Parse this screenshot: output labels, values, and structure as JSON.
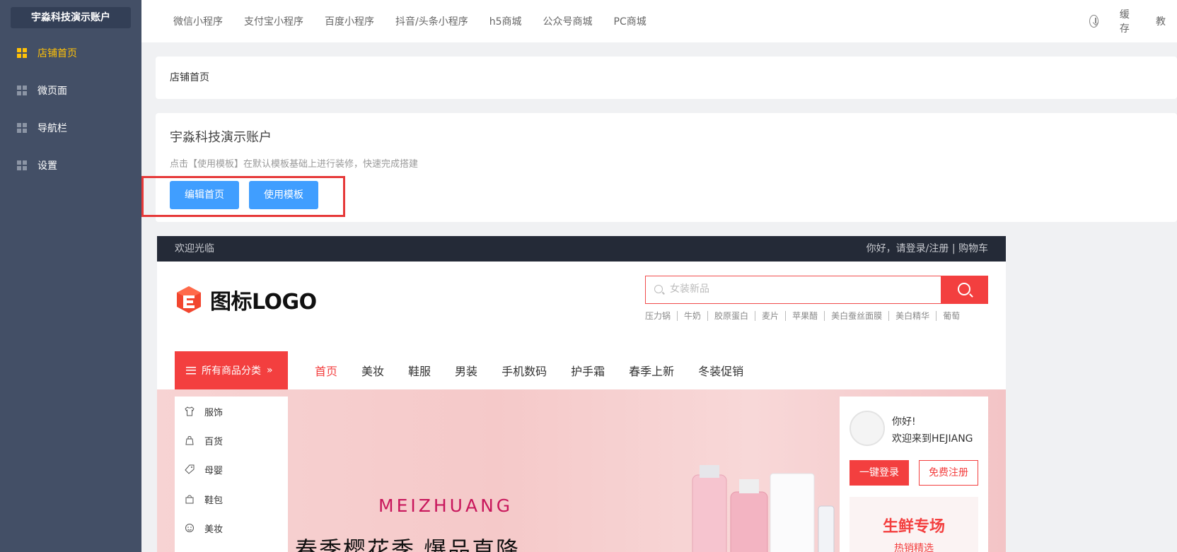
{
  "sidebar": {
    "account": "宇淼科技演示账户",
    "items": [
      {
        "label": "店铺首页"
      },
      {
        "label": "微页面"
      },
      {
        "label": "导航栏"
      },
      {
        "label": "设置"
      }
    ]
  },
  "topbar": {
    "links": [
      "微信小程序",
      "支付宝小程序",
      "百度小程序",
      "抖音/头条小程序",
      "h5商城",
      "公众号商城",
      "PC商城"
    ],
    "cache": "缓存",
    "help_cut": "教"
  },
  "breadcrumb": "店铺首页",
  "store": {
    "title": "宇淼科技演示账户",
    "desc": "点击【使用模板】在默认模板基础上进行装修，快速完成搭建",
    "edit_label": "编辑首页",
    "template_label": "使用模板"
  },
  "preview": {
    "welcome": "欢迎光临",
    "user_links": "你好，请登录/注册 | 购物车",
    "logo_text": "图标LOGO",
    "search_placeholder": "女装新品",
    "hot_words": [
      "压力锅",
      "牛奶",
      "胶原蛋白",
      "麦片",
      "苹果醋",
      "美白蚕丝面膜",
      "美白精华",
      "葡萄"
    ],
    "category_button": "所有商品分类",
    "nav": [
      "首页",
      "美妆",
      "鞋服",
      "男装",
      "手机数码",
      "护手霜",
      "春季上新",
      "冬装促销"
    ],
    "categories": [
      {
        "label": "服饰",
        "icon": "shirt-icon"
      },
      {
        "label": "百货",
        "icon": "store-icon"
      },
      {
        "label": "母婴",
        "icon": "tag-icon"
      },
      {
        "label": "鞋包",
        "icon": "bag-icon"
      },
      {
        "label": "美妆",
        "icon": "face-icon"
      }
    ],
    "banner_brand": "MEIZHUANG",
    "banner_slogan": "春季樱花季  爆品直降",
    "greeting": "你好!",
    "welcome_site": "欢迎来到HEJIANG",
    "login_btn": "一键登录",
    "register_btn": "免费注册",
    "fresh_title": "生鲜专场",
    "fresh_sub": "热销精选"
  },
  "colors": {
    "sidebar": "#434f66",
    "accent_yellow": "#ffc107",
    "primary_blue": "#409eff",
    "shop_red": "#f33f3f",
    "highlight_frame": "#e63939"
  }
}
